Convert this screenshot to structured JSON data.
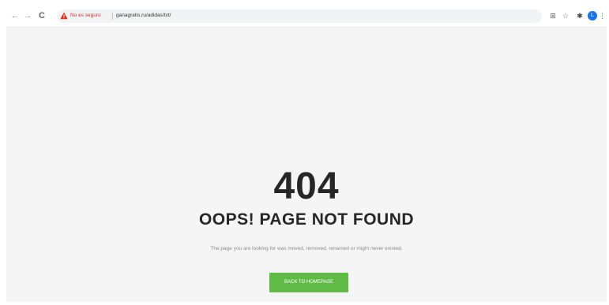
{
  "browser": {
    "back_icon": "←",
    "forward_icon": "→",
    "reload_icon": "C",
    "insecure_label": "No es seguro",
    "url": "ganagratis.ru/adidas/txt/",
    "translate_icon": "⊞",
    "star_icon": "☆",
    "extensions_icon": "✱",
    "avatar_letter": "L",
    "menu_icon": "⋮",
    "colors": {
      "warning": "#d93025",
      "avatar": "#1a73e8"
    }
  },
  "error_page": {
    "code": "404",
    "title": "OOPS! PAGE NOT FOUND",
    "description": "The page you are looking for was moved, removed, renamed or might never existed.",
    "button_label": "BACK TO HOMEPAGE",
    "colors": {
      "background": "#f5f5f5",
      "button": "#5fba46",
      "heading": "#262626"
    }
  }
}
